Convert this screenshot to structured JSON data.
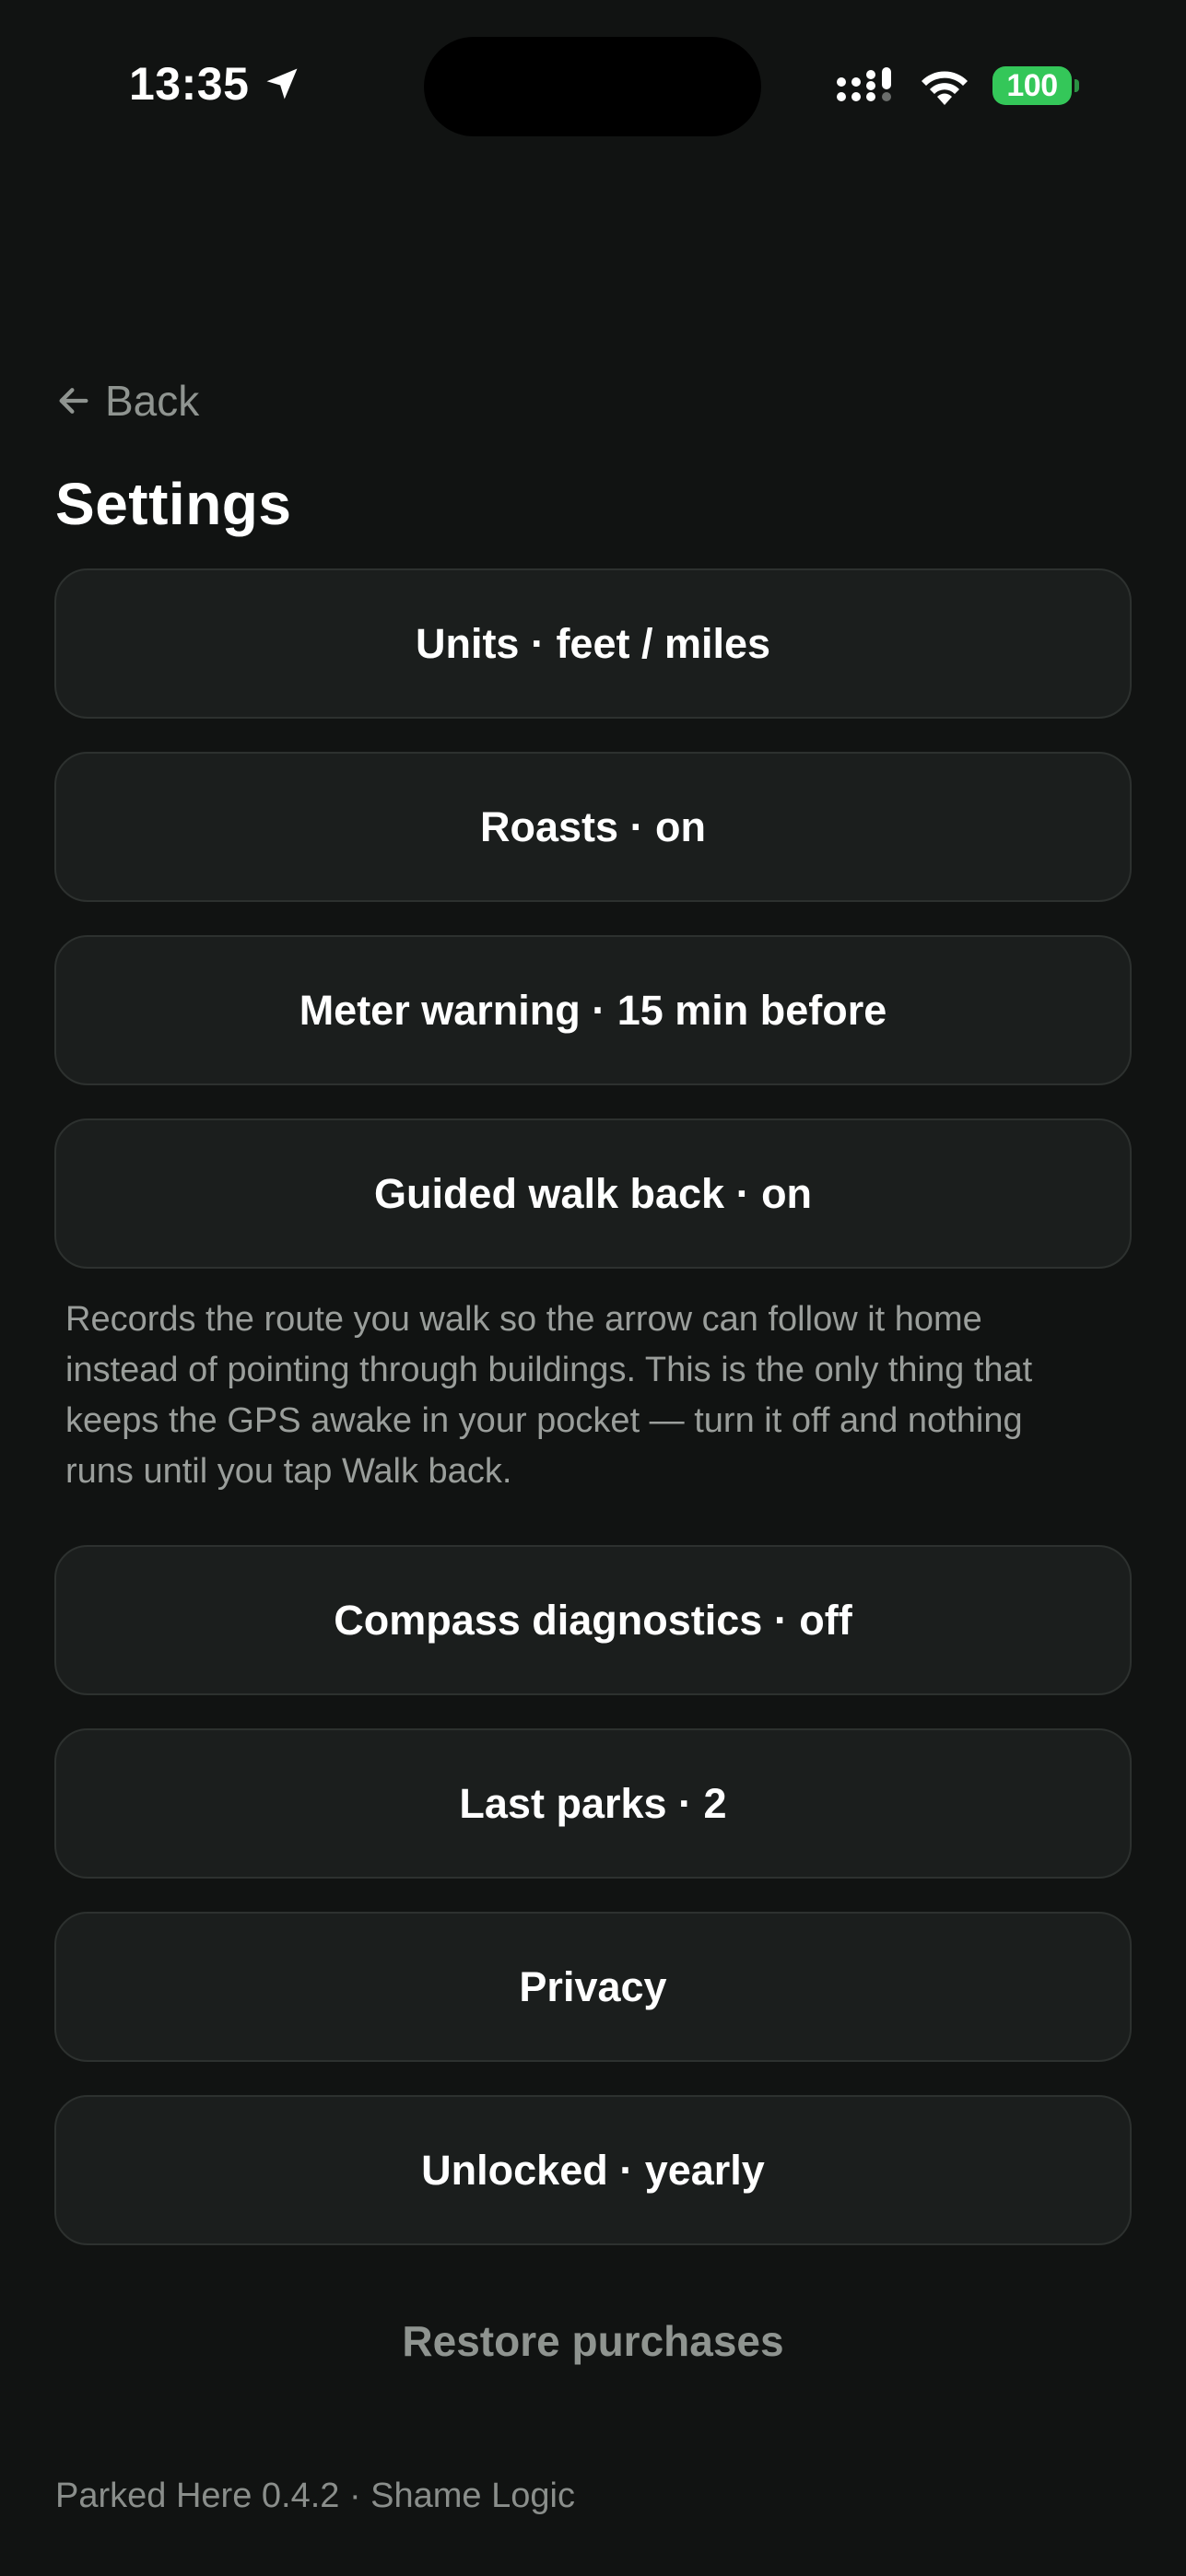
{
  "status_bar": {
    "time": "13:35",
    "battery": "100",
    "battery_color": "#34c759"
  },
  "nav": {
    "back_label": "Back"
  },
  "page_title": "Settings",
  "settings": [
    {
      "label": "Units · feet / miles"
    },
    {
      "label": "Roasts · on"
    },
    {
      "label": "Meter warning · 15 min before"
    },
    {
      "label": "Guided walk back · on"
    },
    {
      "label": "Compass diagnostics · off"
    },
    {
      "label": "Last parks · 2"
    },
    {
      "label": "Privacy"
    },
    {
      "label": "Unlocked · yearly"
    }
  ],
  "walk_back_note": "Records the route you walk so the arrow can follow it home instead of pointing through buildings. This is the only thing that keeps the GPS awake in your pocket — turn it off and nothing runs until you tap Walk back.",
  "restore_label": "Restore purchases",
  "footer_text": "Parked Here 0.4.2 · Shame Logic",
  "icons": {
    "location": "location-arrow-icon",
    "signal": "cellular-signal-icon",
    "wifi": "wifi-icon",
    "battery": "battery-icon",
    "back": "arrow-left-icon"
  }
}
